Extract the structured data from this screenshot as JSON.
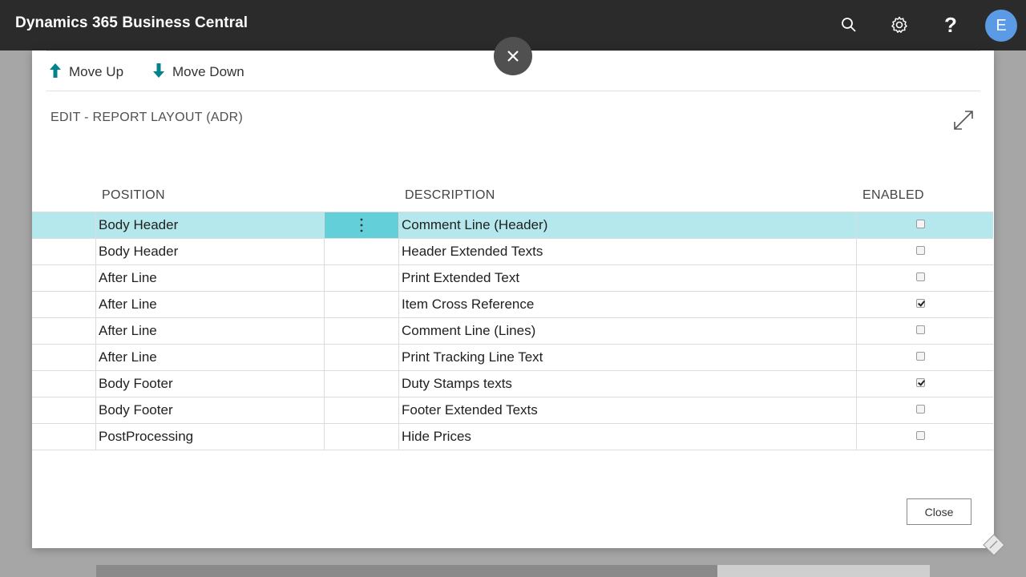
{
  "app": {
    "title": "Dynamics 365 Business Central",
    "user_initial": "E"
  },
  "actions": {
    "move_up": "Move Up",
    "move_down": "Move Down"
  },
  "dialog": {
    "title": "EDIT - REPORT LAYOUT (ADR)",
    "close_label": "Close"
  },
  "table": {
    "headers": {
      "position": "POSITION",
      "description": "DESCRIPTION",
      "enabled": "ENABLED"
    },
    "rows": [
      {
        "position": "Body Header",
        "description": "Comment Line (Header)",
        "enabled": false
      },
      {
        "position": "Body Header",
        "description": "Header Extended Texts",
        "enabled": false
      },
      {
        "position": "After Line",
        "description": "Print Extended Text",
        "enabled": false
      },
      {
        "position": "After Line",
        "description": "Item Cross Reference",
        "enabled": true
      },
      {
        "position": "After Line",
        "description": "Comment Line (Lines)",
        "enabled": false
      },
      {
        "position": "After Line",
        "description": "Print Tracking Line Text",
        "enabled": false
      },
      {
        "position": "Body Footer",
        "description": "Duty Stamps texts",
        "enabled": true
      },
      {
        "position": "Body Footer",
        "description": "Footer Extended Texts",
        "enabled": false
      },
      {
        "position": "PostProcessing",
        "description": "Hide Prices",
        "enabled": false
      }
    ],
    "selected_row": 0
  },
  "icons": {
    "search": "search-icon",
    "settings": "gear-icon",
    "help": "help-icon",
    "move_up": "arrow-up-icon",
    "move_down": "arrow-down-icon",
    "close": "close-icon",
    "expand": "expand-icon",
    "row_menu": "more-vertical-icon"
  },
  "colors": {
    "appbar": "#2b2b2b",
    "accent_teal": "#00838f",
    "selected_row": "#b4e8ec",
    "selected_menu_cell": "#62cfd9",
    "avatar": "#5b9be6"
  }
}
